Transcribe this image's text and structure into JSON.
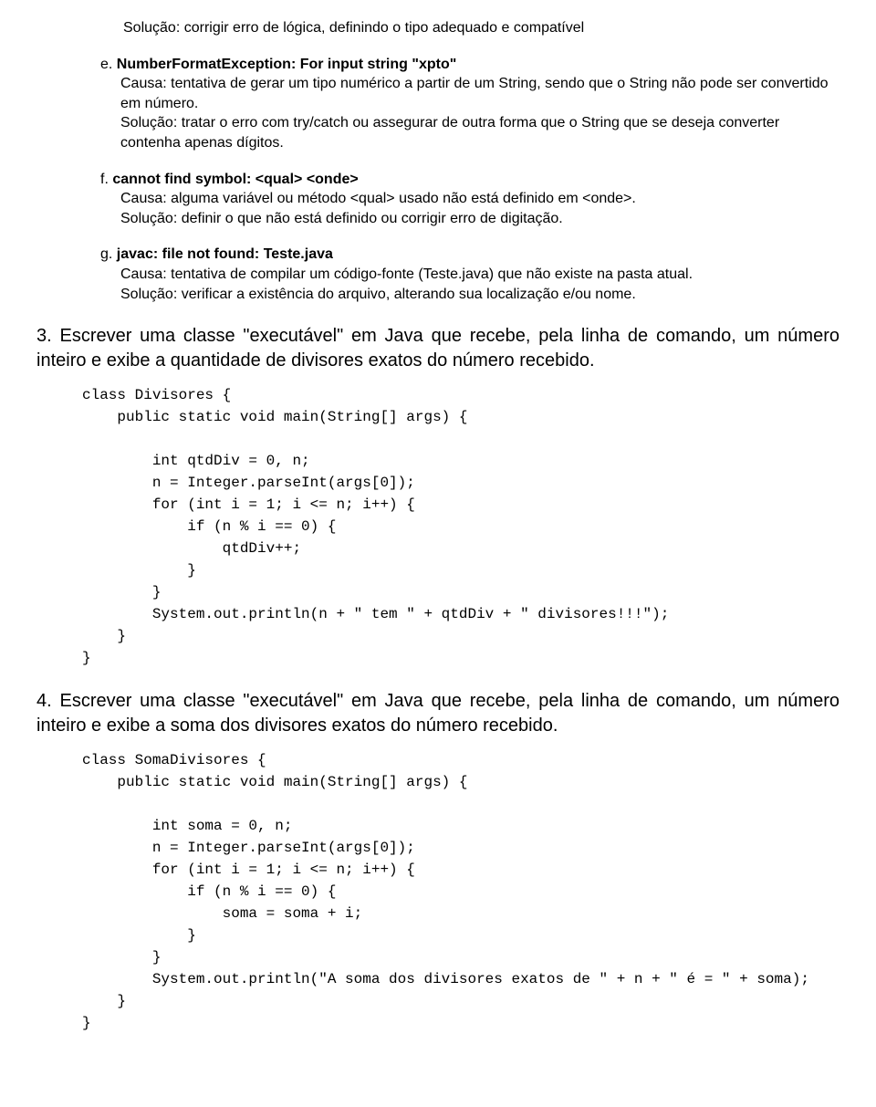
{
  "top_solution": "Solução: corrigir erro de lógica, definindo o tipo adequado e compatível",
  "item_e": {
    "letter": "e.",
    "title": "NumberFormatException: For input string \"xpto\"",
    "causa": "Causa: tentativa de gerar um tipo numérico a partir de um String, sendo que o String não pode ser convertido em número.",
    "solucao": "Solução: tratar o erro com try/catch ou assegurar de outra forma que o String que se deseja converter contenha apenas dígitos."
  },
  "item_f": {
    "letter": "f.",
    "title": "cannot find symbol: <qual> <onde>",
    "causa": "Causa: alguma variável ou método <qual> usado não está definido em <onde>.",
    "solucao": "Solução: definir o que não está definido ou corrigir erro de digitação."
  },
  "item_g": {
    "letter": "g.",
    "title": "javac: file not found: Teste.java",
    "causa": "Causa: tentativa de compilar um código-fonte (Teste.java) que não existe na pasta atual.",
    "solucao": "Solução: verificar a existência do arquivo, alterando sua localização e/ou nome."
  },
  "q3": {
    "num": "3.",
    "text": "Escrever uma classe \"executável\" em Java que recebe, pela linha de comando, um número inteiro e exibe a quantidade de divisores exatos do número recebido.",
    "code": "class Divisores {\n    public static void main(String[] args) {\n\n        int qtdDiv = 0, n;\n        n = Integer.parseInt(args[0]);\n        for (int i = 1; i <= n; i++) {\n            if (n % i == 0) {\n                qtdDiv++;\n            }\n        }\n        System.out.println(n + \" tem \" + qtdDiv + \" divisores!!!\");\n    }\n}"
  },
  "q4": {
    "num": "4.",
    "text": "Escrever uma classe \"executável\" em Java que recebe, pela linha de comando, um número inteiro e exibe a soma dos divisores exatos do número recebido.",
    "code": "class SomaDivisores {\n    public static void main(String[] args) {\n\n        int soma = 0, n;\n        n = Integer.parseInt(args[0]);\n        for (int i = 1; i <= n; i++) {\n            if (n % i == 0) {\n                soma = soma + i;\n            }\n        }\n        System.out.println(\"A soma dos divisores exatos de \" + n + \" é = \" + soma);\n    }\n}"
  }
}
